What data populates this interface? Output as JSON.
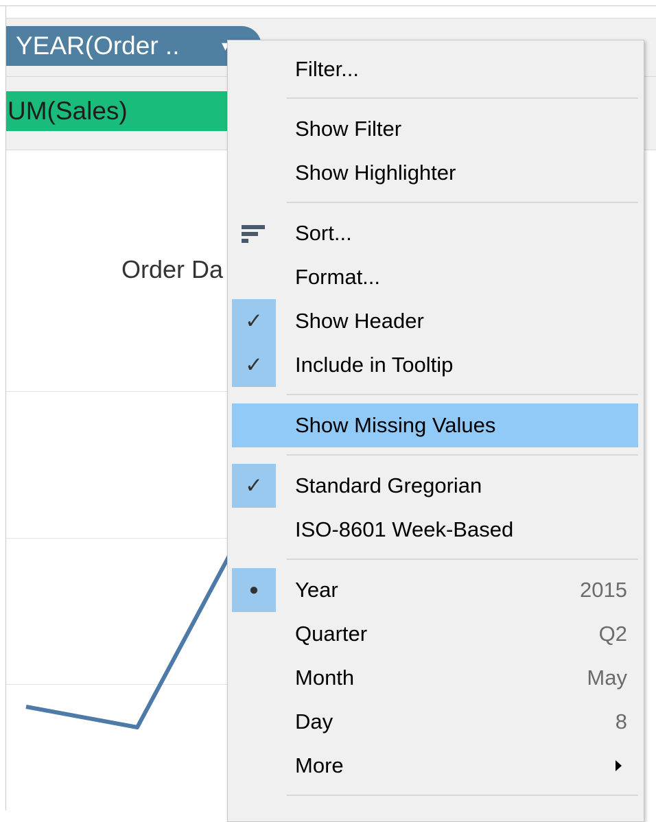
{
  "shelves": {
    "columns_pill": "YEAR(Order ..",
    "rows_pill": "UM(Sales)"
  },
  "view": {
    "header_text": "Order Da"
  },
  "menu": {
    "filter": "Filter...",
    "show_filter": "Show Filter",
    "show_highlighter": "Show Highlighter",
    "sort": "Sort...",
    "format": "Format...",
    "show_header": "Show Header",
    "include_in_tooltip": "Include in Tooltip",
    "show_missing_values": "Show Missing Values",
    "standard_gregorian": "Standard Gregorian",
    "iso_week_based": "ISO-8601 Week-Based",
    "year": "Year",
    "year_value": "2015",
    "quarter": "Quarter",
    "quarter_value": "Q2",
    "month": "Month",
    "month_value": "May",
    "day": "Day",
    "day_value": "8",
    "more": "More"
  },
  "icons": {
    "check": "✓",
    "bullet": "●",
    "caret": "▾"
  },
  "colors": {
    "columns_pill": "#4f7fa1",
    "rows_pill": "#1abc7c",
    "menu_highlight": "#91c9f7",
    "checked_box": "#99c9ef",
    "line": "#4d7aa7"
  }
}
